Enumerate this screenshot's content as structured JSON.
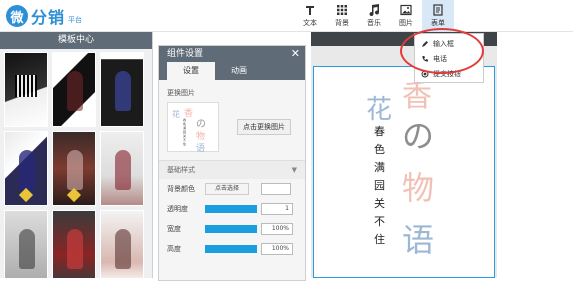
{
  "logo": {
    "badge": "微",
    "name": "分销",
    "sub": "平台"
  },
  "toolbar": {
    "items": [
      {
        "label": "文本",
        "icon": "text-icon"
      },
      {
        "label": "背景",
        "icon": "grid-icon"
      },
      {
        "label": "音乐",
        "icon": "music-icon"
      },
      {
        "label": "图片",
        "icon": "image-icon"
      },
      {
        "label": "表单",
        "icon": "form-icon",
        "active": true
      }
    ]
  },
  "template_panel": {
    "title": "模板中心"
  },
  "settings": {
    "title": "组件设置",
    "tabs": [
      "设置",
      "动画"
    ],
    "replace_image_label": "更换图片",
    "replace_image_button": "点击更换图片",
    "basic_style_label": "基础样式",
    "bg_color_label": "背景颜色",
    "bg_color_button": "点击选择",
    "opacity_label": "透明度",
    "opacity_value": "1",
    "width_label": "宽度",
    "width_value": "100%",
    "height_label": "高度",
    "height_value": "100%"
  },
  "canvas": {
    "title_chars": {
      "hua": "花",
      "xiang": "香",
      "no": "の",
      "wu": "物",
      "yu": "语"
    },
    "vertical_text": "春色满园关不住"
  },
  "form_dropdown": {
    "items": [
      {
        "label": "输入框",
        "icon": "pen-icon"
      },
      {
        "label": "电话",
        "icon": "phone-icon"
      },
      {
        "label": "提交按钮",
        "icon": "radio-icon"
      }
    ]
  },
  "colors": {
    "header_bg": "#5f6b77",
    "accent_blue": "#2d8fd5",
    "slider_blue": "#1a9ee0",
    "highlight_red": "#e23b3b",
    "pink": "#f2c0b6",
    "light_blue": "#9db8d6"
  }
}
